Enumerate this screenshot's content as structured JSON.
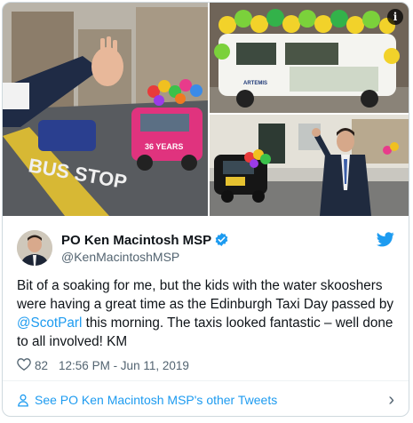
{
  "author": {
    "name": "PO Ken Macintosh MSP",
    "handle": "@KenMacintoshMSP"
  },
  "tweet": {
    "text_before": "Bit of a soaking for me, but the kids with the water skooshers were having a great time as the Edinburgh Taxi Day passed by ",
    "mention": "@ScotParl",
    "text_after": " this morning. The taxis looked fantastic – well done to all involved! KM",
    "likes": "82",
    "timestamp": "12:56 PM - Jun 11, 2019"
  },
  "photos": {
    "info_label": "i",
    "bus_stop_text": "BUS STOP",
    "taxi_sign": "36 YEARS",
    "sticker_text": "ARTEMIS"
  },
  "footer": {
    "link_label": "See PO Ken Macintosh MSP's other Tweets",
    "chevron": "›"
  },
  "colors": {
    "accent": "#1d9bf0",
    "text": "#0f1419",
    "muted": "#536471"
  }
}
